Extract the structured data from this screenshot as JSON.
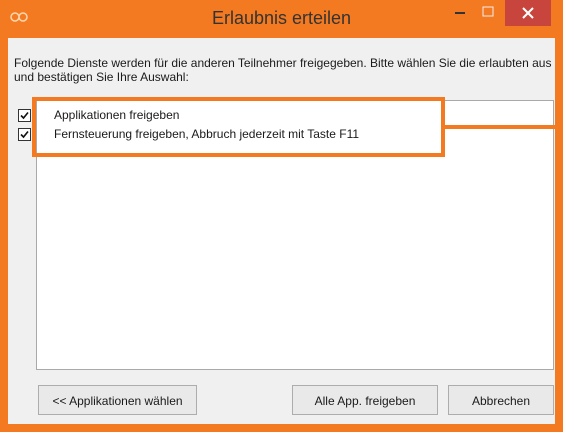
{
  "window": {
    "title": "Erlaubnis erteilen",
    "accent_color": "#f47a22",
    "close_color": "#c7453c",
    "icons": {
      "app": "teamviewer-logo-icon",
      "minimize": "minimize-icon",
      "maximize": "maximize-icon",
      "close": "close-icon"
    }
  },
  "description": "Folgende Dienste werden für die anderen Teilnehmer freigegeben. Bitte wählen Sie die erlaubten aus und bestätigen Sie Ihre Auswahl:",
  "list": {
    "items": [
      {
        "label": "Applikationen freigeben",
        "checked": true
      },
      {
        "label": "Fernsteuerung freigeben, Abbruch jederzeit mit Taste F11",
        "checked": true
      }
    ]
  },
  "buttons": {
    "back_label": "<< Applikationen wählen",
    "share_all_label": "Alle App. freigeben",
    "cancel_label": "Abbrechen"
  }
}
